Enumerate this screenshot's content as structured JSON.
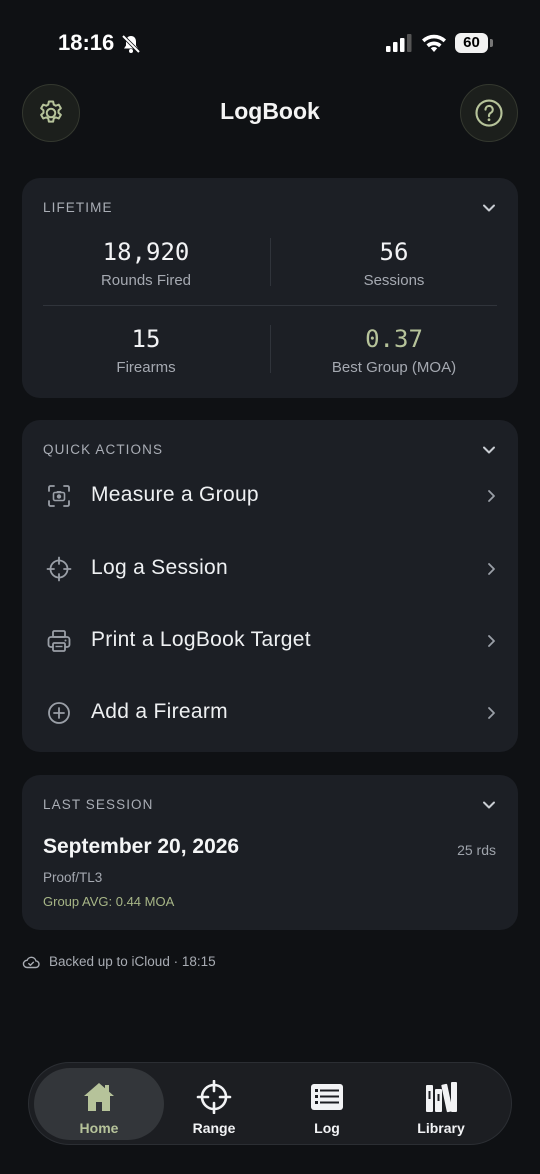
{
  "status_bar": {
    "time": "18:16",
    "battery": "60"
  },
  "header": {
    "title": "LogBook"
  },
  "lifetime": {
    "heading": "LIFETIME",
    "stats": [
      {
        "value": "18,920",
        "label": "Rounds Fired"
      },
      {
        "value": "56",
        "label": "Sessions"
      },
      {
        "value": "15",
        "label": "Firearms"
      },
      {
        "value": "0.37",
        "label": "Best Group (MOA)"
      }
    ]
  },
  "quick_actions": {
    "heading": "QUICK ACTIONS",
    "items": [
      {
        "label": "Measure a Group",
        "icon": "camera-frame-icon"
      },
      {
        "label": "Log a Session",
        "icon": "crosshair-icon"
      },
      {
        "label": "Print a LogBook Target",
        "icon": "printer-icon"
      },
      {
        "label": "Add a Firearm",
        "icon": "plus-circle-icon"
      }
    ]
  },
  "last_session": {
    "heading": "LAST SESSION",
    "date": "September 20, 2026",
    "rounds": "25 rds",
    "ammo": "Proof/TL3",
    "group_avg": "Group AVG: 0.44 MOA"
  },
  "backup": {
    "text": "Backed up to iCloud · 18:15"
  },
  "tabs": [
    {
      "label": "Home",
      "icon": "house-icon",
      "active": true
    },
    {
      "label": "Range",
      "icon": "crosshair-icon"
    },
    {
      "label": "Log",
      "icon": "list-icon"
    },
    {
      "label": "Library",
      "icon": "books-icon"
    }
  ],
  "colors": {
    "accent": "#b6c39a",
    "background": "#0f1114",
    "card": "#1c1f25"
  }
}
